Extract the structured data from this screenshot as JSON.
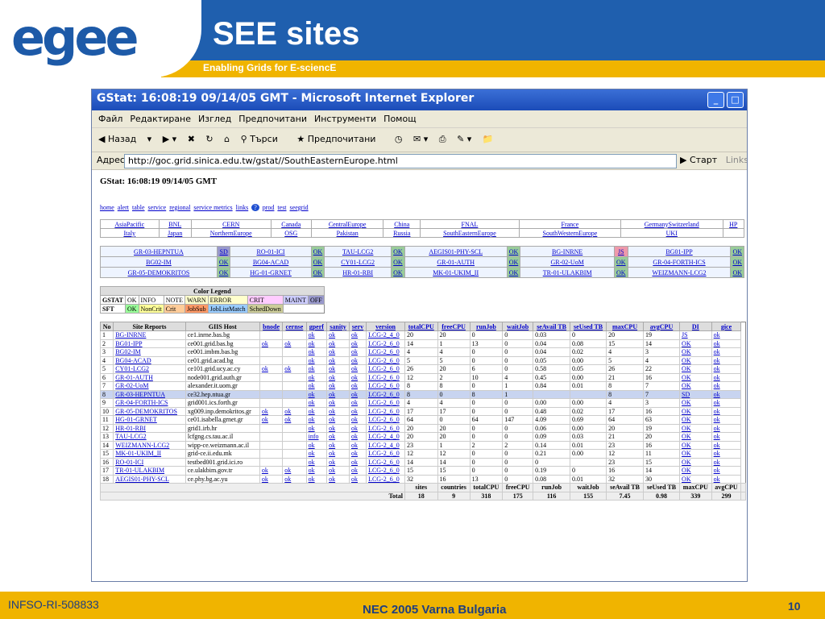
{
  "slide": {
    "title": "SEE sites",
    "subtitle": "Enabling Grids for E-sciencE",
    "logo_text": "egee",
    "footer_left": "INFSO-RI-508833",
    "footer_center": "NEC 2005 Varna Bulgaria",
    "page_number": "10"
  },
  "colors": {
    "brand_blue": "#1f5fae",
    "brand_yellow": "#f0b400"
  },
  "window": {
    "title": "GStat: 16:08:19 09/14/05 GMT - Microsoft Internet Explorer",
    "menu": [
      "Файл",
      "Редактиране",
      "Изглед",
      "Предпочитани",
      "Инструменти",
      "Помощ"
    ],
    "toolbar": {
      "back": "Назад",
      "search": "Търси",
      "favorites": "Предпочитани"
    },
    "address_label": "Адрес",
    "address_value": "http://goc.grid.sinica.edu.tw/gstat//SouthEasternEurope.html",
    "go_label": "Старт",
    "links_label": "Links"
  },
  "page": {
    "heading": "GStat: 16:08:19 09/14/05 GMT",
    "nav": [
      "home",
      "alert",
      "table",
      "service",
      "regional",
      "service metrics",
      "links",
      "prod",
      "test",
      "seegrid"
    ],
    "regions_row1": [
      "AsiaPacific",
      "BNL",
      "CERN",
      "Canada",
      "CentralEurope",
      "China",
      "FNAL",
      "France",
      "GermanySwitzerland",
      "HP"
    ],
    "regions_row2": [
      "Italy",
      "Japan",
      "NorthernEurope",
      "OSG",
      "Pakistan",
      "Russia",
      "SouthEasternEurope",
      "SouthWesternEurope",
      "UKI",
      ""
    ],
    "site_grid": [
      [
        [
          "GR-03-HEPNTUA",
          "SD"
        ],
        [
          "RO-01-ICI",
          "OK"
        ],
        [
          "TAU-LCG2",
          "OK"
        ],
        [
          "AEGIS01-PHY-SCL",
          "OK"
        ],
        [
          "BG-INRNE",
          "JS"
        ],
        [
          "BG01-IPP",
          "OK"
        ]
      ],
      [
        [
          "BG02-IM",
          "OK"
        ],
        [
          "BG04-ACAD",
          "OK"
        ],
        [
          "CY01-LCG2",
          "OK"
        ],
        [
          "GR-01-AUTH",
          "OK"
        ],
        [
          "GR-02-UoM",
          "OK"
        ],
        [
          "GR-04-FORTH-ICS",
          "OK"
        ]
      ],
      [
        [
          "GR-05-DEMOKRITOS",
          "OK"
        ],
        [
          "HG-01-GRNET",
          "OK"
        ],
        [
          "HR-01-RBI",
          "OK"
        ],
        [
          "MK-01-UKIM_II",
          "OK"
        ],
        [
          "TR-01-ULAKBIM",
          "OK"
        ],
        [
          "WEIZMANN-LCG2",
          "OK"
        ]
      ]
    ],
    "legend": {
      "title": "Color Legend",
      "row1_label": "GSTAT",
      "row1": [
        "OK",
        "INFO",
        "NOTE",
        "WARN",
        "ERROR",
        "CRIT",
        "MAINT",
        "OFF"
      ],
      "row2_label": "SFT",
      "row2": [
        "OK",
        "NonCrit",
        "Crit",
        "JobSub",
        "JobListMatch",
        "SchedDown"
      ]
    },
    "report": {
      "headers": [
        "No",
        "Site Reports",
        "GIIS Host",
        "bnode",
        "cernse",
        "gperf",
        "sanity",
        "serv",
        "version",
        "totalCPU",
        "freeCPU",
        "runJob",
        "waitJob",
        "seAvail TB",
        "seUsed TB",
        "maxCPU",
        "avgCPU",
        "DI",
        "gice"
      ],
      "rows": [
        [
          "1",
          "BG-INRNE",
          "ce1.inrne.bas.bg",
          "",
          "",
          "ok",
          "ok",
          "ok",
          "LCG-2_4_0",
          "20",
          "20",
          "0",
          "0",
          "0.03",
          "0",
          "20",
          "19",
          "JS",
          "ok"
        ],
        [
          "2",
          "BG01-IPP",
          "ce001.grid.bas.bg",
          "ok",
          "ok",
          "ok",
          "ok",
          "ok",
          "LCG-2_6_0",
          "14",
          "1",
          "13",
          "0",
          "0.04",
          "0.08",
          "15",
          "14",
          "OK",
          "ok"
        ],
        [
          "3",
          "BG02-IM",
          "ce001.imbm.bas.bg",
          "",
          "",
          "ok",
          "ok",
          "ok",
          "LCG-2_6_0",
          "4",
          "4",
          "0",
          "0",
          "0.04",
          "0.02",
          "4",
          "3",
          "OK",
          "ok"
        ],
        [
          "4",
          "BG04-ACAD",
          "ce01.grid.acad.bg",
          "",
          "",
          "ok",
          "ok",
          "ok",
          "LCG-2_6_0",
          "5",
          "5",
          "0",
          "0",
          "0.05",
          "0.00",
          "5",
          "4",
          "OK",
          "ok"
        ],
        [
          "5",
          "CY01-LCG2",
          "ce101.grid.ucy.ac.cy",
          "ok",
          "ok",
          "ok",
          "ok",
          "ok",
          "LCG-2_6_0",
          "26",
          "20",
          "6",
          "0",
          "0.58",
          "0.05",
          "26",
          "22",
          "OK",
          "ok"
        ],
        [
          "6",
          "GR-01-AUTH",
          "node001.grid.auth.gr",
          "",
          "",
          "ok",
          "ok",
          "ok",
          "LCG-2_6_0",
          "12",
          "2",
          "10",
          "4",
          "0.45",
          "0.00",
          "21",
          "16",
          "OK",
          "ok"
        ],
        [
          "7",
          "GR-02-UoM",
          "alexander.it.uom.gr",
          "",
          "",
          "ok",
          "ok",
          "ok",
          "LCG-2_6_0",
          "8",
          "8",
          "0",
          "1",
          "0.84",
          "0.01",
          "8",
          "7",
          "OK",
          "ok"
        ],
        [
          "8",
          "GR-03-HEPNTUA",
          "ce32.hep.ntua.gr",
          "",
          "",
          "ok",
          "ok",
          "ok",
          "LCG-2_6_0",
          "8",
          "0",
          "8",
          "1",
          "",
          "",
          "8",
          "7",
          "SD",
          "ok"
        ],
        [
          "9",
          "GR-04-FORTH-ICS",
          "grid001.ics.forth.gr",
          "",
          "",
          "ok",
          "ok",
          "ok",
          "LCG-2_6_0",
          "4",
          "4",
          "0",
          "0",
          "0.00",
          "0.00",
          "4",
          "3",
          "OK",
          "ok"
        ],
        [
          "10",
          "GR-05-DEMOKRITOS",
          "xg009.inp.demokritos.gr",
          "ok",
          "ok",
          "ok",
          "ok",
          "ok",
          "LCG-2_6_0",
          "17",
          "17",
          "0",
          "0",
          "0.48",
          "0.02",
          "17",
          "16",
          "OK",
          "ok"
        ],
        [
          "11",
          "HG-01-GRNET",
          "ce01.isabella.grnet.gr",
          "ok",
          "ok",
          "ok",
          "ok",
          "ok",
          "LCG-2_6_0",
          "64",
          "0",
          "64",
          "147",
          "4.09",
          "0.69",
          "64",
          "63",
          "OK",
          "ok"
        ],
        [
          "12",
          "HR-01-RBI",
          "grid1.irb.hr",
          "",
          "",
          "ok",
          "ok",
          "ok",
          "LCG-2_6_0",
          "20",
          "20",
          "0",
          "0",
          "0.06",
          "0.00",
          "20",
          "19",
          "OK",
          "ok"
        ],
        [
          "13",
          "TAU-LCG2",
          "lcfgng.cs.tau.ac.il",
          "",
          "",
          "info",
          "ok",
          "ok",
          "LCG-2_4_0",
          "20",
          "20",
          "0",
          "0",
          "0.09",
          "0.03",
          "21",
          "20",
          "OK",
          "ok"
        ],
        [
          "14",
          "WEIZMANN-LCG2",
          "wipp-ce.weizmann.ac.il",
          "",
          "",
          "ok",
          "ok",
          "ok",
          "LCG-2_4_0",
          "23",
          "1",
          "2",
          "2",
          "0.14",
          "0.01",
          "23",
          "16",
          "OK",
          "ok"
        ],
        [
          "15",
          "MK-01-UKIM_II",
          "grid-ce.ii.edu.mk",
          "",
          "",
          "ok",
          "ok",
          "ok",
          "LCG-2_6_0",
          "12",
          "12",
          "0",
          "0",
          "0.21",
          "0.00",
          "12",
          "11",
          "OK",
          "ok"
        ],
        [
          "16",
          "RO-01-ICI",
          "testbed001.grid.ici.ro",
          "",
          "",
          "ok",
          "ok",
          "ok",
          "LCG-2_6_0",
          "14",
          "14",
          "0",
          "0",
          "0",
          "",
          "23",
          "15",
          "OK",
          "ok"
        ],
        [
          "17",
          "TR-01-ULAKBIM",
          "ce.ulakbim.gov.tr",
          "ok",
          "ok",
          "ok",
          "ok",
          "ok",
          "LCG-2_6_0",
          "15",
          "15",
          "0",
          "0",
          "0.19",
          "0",
          "16",
          "14",
          "OK",
          "ok"
        ],
        [
          "18",
          "AEGIS01-PHY-SCL",
          "ce.phy.bg.ac.yu",
          "ok",
          "ok",
          "ok",
          "ok",
          "ok",
          "LCG-2_6_0",
          "32",
          "16",
          "13",
          "0",
          "0.08",
          "0.01",
          "32",
          "30",
          "OK",
          "ok"
        ]
      ],
      "summary_headers": [
        "sites",
        "countries",
        "totalCPU",
        "freeCPU",
        "runJob",
        "waitJob",
        "seAvail TB",
        "seUsed TB",
        "maxCPU",
        "avgCPU"
      ],
      "total_label": "Total",
      "summary_values": [
        "18",
        "9",
        "318",
        "175",
        "116",
        "155",
        "7.45",
        "0.98",
        "339",
        "299"
      ]
    }
  }
}
